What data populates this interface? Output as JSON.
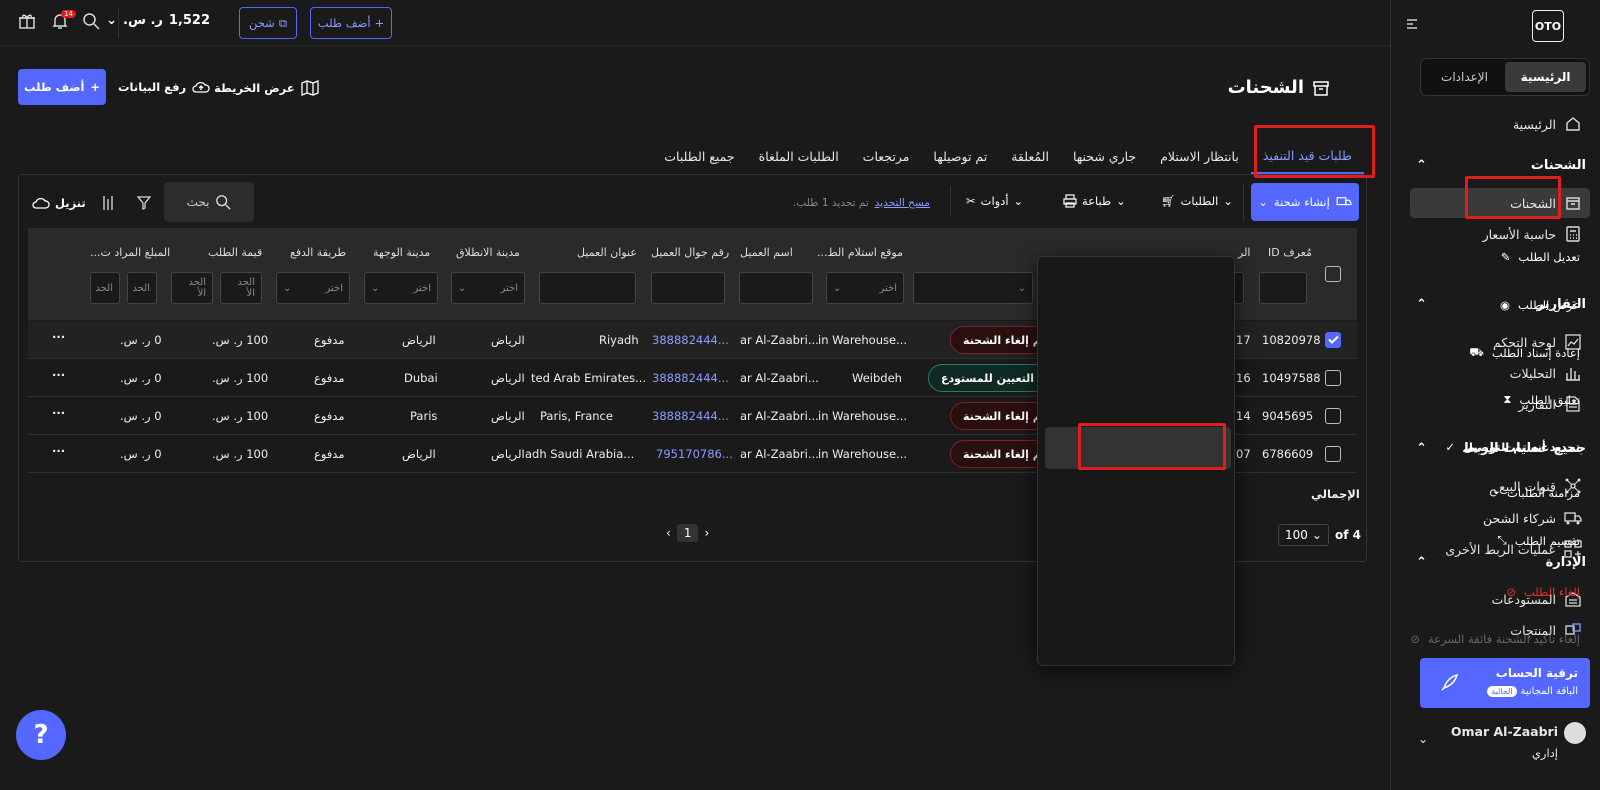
{
  "app": {
    "logo": "OTO"
  },
  "sidebar": {
    "segment": {
      "home": "الرئيسية",
      "settings": "الإعدادات"
    },
    "home_item": "الرئيسية",
    "sections": {
      "shipments": "الشحنات",
      "reports": "التقارير",
      "integrations": "جميع عمليات الربط",
      "management": "الإدارة"
    },
    "items": {
      "shipments": "الشحنات",
      "price_calc": "حاسبة الأسعار",
      "dashboard": "لوحة التحكم",
      "analytics": "التحليلات",
      "reports": "التقارير",
      "sales_channels": "قنوات البيع",
      "carriers": "شركاء الشحن",
      "other_integrations": "عمليات الربط الأخرى",
      "warehouses": "المستودعات",
      "products": "المنتجات"
    },
    "upgrade": {
      "title": "ترقية الحساب",
      "plan": "الباقة المجانية",
      "badge": "الحالية"
    },
    "user": {
      "name": "Omar Al-Zaabri",
      "role": "إداري"
    }
  },
  "topbar": {
    "add_order": "أضف طلب",
    "ship": "شحن",
    "balance": "1,522",
    "currency": "ر. س.",
    "notif_count": "14"
  },
  "header": {
    "title": "الشحنات",
    "map_view": "عرض الخريطة",
    "upload_data": "رفع البيانات",
    "add_order": "أضف طلب"
  },
  "tabs": [
    {
      "label": "طلبات قيد التنفيذ",
      "active": true
    },
    {
      "label": "بانتظار الاستلام"
    },
    {
      "label": "جاري شحنها"
    },
    {
      "label": "المُعلقة"
    },
    {
      "label": "تم توصيلها"
    },
    {
      "label": "مرتجعات"
    },
    {
      "label": "الطلبات الملغاة"
    },
    {
      "label": "جميع الطلبات"
    }
  ],
  "toolbar": {
    "create_shipment": "إنشاء شحنة",
    "orders": "الطلبات",
    "print": "طباعة",
    "tools": "أدوات",
    "selected_text": "تم تحديد 1 طلب.",
    "clear_selection": "مسح التحديد",
    "search_placeholder": "بحث",
    "download": "تنزيل"
  },
  "table": {
    "headers": {
      "id": "مُعرف ID",
      "r": "الر",
      "pickup": "موقع استلام الط...",
      "customer_name": "اسم العميل",
      "customer_phone": "رقم جوال العميل",
      "customer_address": "عنوان العميل",
      "origin_city": "مدينة الانطلاق",
      "dest_city": "مدينة الوجهة",
      "payment": "طريقة الدفع",
      "order_value": "قيمة الطلب",
      "amount": "المبلغ المراد ت..."
    },
    "filter": {
      "choose": "اختر",
      "min": "الحد الأ",
      "max": "الحد"
    },
    "rows": [
      {
        "id": "10820978",
        "r": "17",
        "status": "تم إلغاء الشحنة",
        "status_color": "red",
        "pickup": "...in Warehouse",
        "name": "...ar Al-Zaabri",
        "phone": "...388882444",
        "address": "Riyadh",
        "origin": "الرياض",
        "dest": "الرياض",
        "payment": "مدفوع",
        "value": "100 ر. س.",
        "amount": "0 ر. س.",
        "checked": true
      },
      {
        "id": "10497588",
        "r": "16",
        "status": "تم التعيين للمستودع",
        "status_color": "green",
        "pickup": "Weibdeh",
        "name": "...ar Al-Zaabri",
        "phone": "...388882444",
        "address": "...ted Arab Emirates",
        "origin": "الرياض",
        "dest": "Dubai",
        "payment": "مدفوع",
        "value": "100 ر. س.",
        "amount": "0 ر. س.",
        "checked": false
      },
      {
        "id": "9045695",
        "r": "14",
        "status": "تم إلغاء الشحنة",
        "status_color": "red",
        "pickup": "...in Warehouse",
        "name": "...ar Al-Zaabri",
        "phone": "...388882444",
        "address": "Paris, France",
        "origin": "الرياض",
        "dest": "Paris",
        "payment": "مدفوع",
        "value": "100 ر. س.",
        "amount": "0 ر. س.",
        "checked": false
      },
      {
        "id": "6786609",
        "r": "07",
        "status": "تم إلغاء الشحنة",
        "status_color": "red",
        "pickup": "...in Warehouse",
        "name": "...ar Al-Zaabri",
        "phone": "...795170786",
        "address": "...adh Saudi Arabia",
        "origin": "الرياض",
        "dest": "الرياض",
        "payment": "مدفوع",
        "value": "100 ر. س.",
        "amount": "0 ر. س.",
        "checked": false
      }
    ],
    "total_label": "الإجمالي"
  },
  "pagination": {
    "page_size": "100",
    "of_text": "4 of",
    "current_page": "1"
  },
  "menu": {
    "edit": "تعديل الطلب",
    "view": "عرض الطلب",
    "reassign": "إعادة إسناد الطلب",
    "suspend": "تعليق الطلب",
    "mark_delivered": "تحديد أنه تم التوصيل",
    "sync": "مزامنة الطلبات",
    "split": "تقسيم الطلب",
    "cancel": "إلغاء الطلب",
    "cancel_express": "إلغاء تأكيد الشحنة فائقة السرعة"
  },
  "colors": {
    "accent": "#5468ff",
    "danger": "#e01e1e",
    "bg": "#1a1a1a"
  },
  "help": "?"
}
